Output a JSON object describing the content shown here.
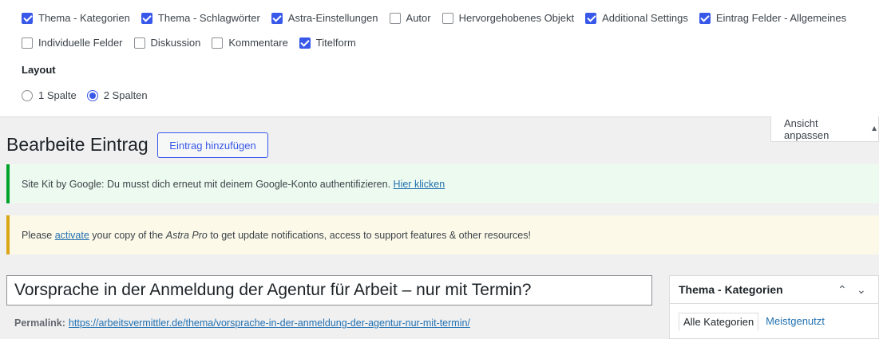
{
  "screen_options": {
    "row1": [
      {
        "label": "Thema - Kategorien",
        "checked": true
      },
      {
        "label": "Thema - Schlagwörter",
        "checked": true
      },
      {
        "label": "Astra-Einstellungen",
        "checked": true
      },
      {
        "label": "Autor",
        "checked": false
      },
      {
        "label": "Hervorgehobenes Objekt",
        "checked": false
      },
      {
        "label": "Additional Settings",
        "checked": true
      },
      {
        "label": "Eintrag Felder - Allgemeines",
        "checked": true
      }
    ],
    "row2": [
      {
        "label": "Individuelle Felder",
        "checked": false
      },
      {
        "label": "Diskussion",
        "checked": false
      },
      {
        "label": "Kommentare",
        "checked": false
      },
      {
        "label": "Titelform",
        "checked": true
      }
    ],
    "layout_label": "Layout",
    "layout_options": [
      {
        "label": "1 Spalte",
        "selected": false
      },
      {
        "label": "2 Spalten",
        "selected": true
      }
    ],
    "toggle_label": "Ansicht anpassen",
    "toggle_arrow": "▲"
  },
  "header": {
    "title": "Bearbeite Eintrag",
    "add_button": "Eintrag hinzufügen"
  },
  "notices": {
    "sitekit": {
      "text": "Site Kit by Google: Du musst dich erneut mit deinem Google-Konto authentifizieren.",
      "link": "Hier klicken"
    },
    "astra": {
      "before": "Please",
      "link": "activate",
      "middle": "your copy of the",
      "product": "Astra Pro",
      "after": "to get update notifications, access to support features & other resources!"
    }
  },
  "editor": {
    "title_value": "Vorsprache in der Anmeldung der Agentur für Arbeit – nur mit Termin?",
    "permalink_label": "Permalink:",
    "permalink_url": "https://arbeitsvermittler.de/thema/vorsprache-in-der-anmeldung-der-agentur-nur-mit-termin/"
  },
  "sidebar": {
    "box_title": "Thema - Kategorien",
    "tabs": [
      "Alle Kategorien",
      "Meistgenutzt"
    ]
  },
  "colors": {
    "accent": "#3858e9",
    "link": "#2271b1",
    "success": "#00a32a",
    "warning": "#dba617"
  }
}
